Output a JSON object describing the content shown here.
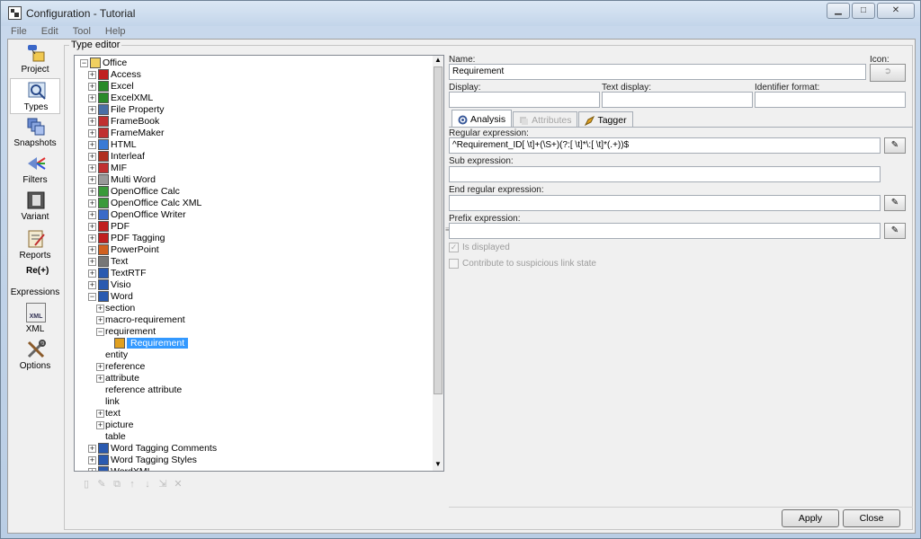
{
  "window": {
    "title": "Configuration - Tutorial"
  },
  "menu": [
    "File",
    "Edit",
    "Tool",
    "Help"
  ],
  "sidebar": [
    {
      "label": "Project",
      "icon": "project-icon"
    },
    {
      "label": "Types",
      "icon": "types-icon",
      "active": true
    },
    {
      "label": "Snapshots",
      "icon": "snapshots-icon"
    },
    {
      "label": "Filters",
      "icon": "filters-icon"
    },
    {
      "label": "Variant",
      "icon": "variant-icon"
    },
    {
      "label": "Reports",
      "icon": "reports-icon"
    },
    {
      "label": "Expressions",
      "icon": "expressions-icon",
      "icon_text": "Re(+)"
    },
    {
      "label": "XML",
      "icon": "xml-icon",
      "icon_text": "XML"
    },
    {
      "label": "Options",
      "icon": "options-icon"
    }
  ],
  "type_editor": {
    "group_title": "Type editor"
  },
  "tree": [
    {
      "label": "Office",
      "depth": 0,
      "exp": "−",
      "icon": "folder-icon",
      "color": "#f0d060"
    },
    {
      "label": "Access",
      "depth": 1,
      "exp": "+",
      "icon": "access-icon",
      "color": "#c02020"
    },
    {
      "label": "Excel",
      "depth": 1,
      "exp": "+",
      "icon": "excel-icon",
      "color": "#2a8a2a"
    },
    {
      "label": "ExcelXML",
      "depth": 1,
      "exp": "+",
      "icon": "excel-xml-icon",
      "color": "#2a8a2a"
    },
    {
      "label": "File Property",
      "depth": 1,
      "exp": "+",
      "icon": "file-property-icon",
      "color": "#4a6fa5"
    },
    {
      "label": "FrameBook",
      "depth": 1,
      "exp": "+",
      "icon": "framebook-icon",
      "color": "#c03030"
    },
    {
      "label": "FrameMaker",
      "depth": 1,
      "exp": "+",
      "icon": "framemaker-icon",
      "color": "#c03030"
    },
    {
      "label": "HTML",
      "depth": 1,
      "exp": "+",
      "icon": "html-icon",
      "color": "#3a7ad5"
    },
    {
      "label": "Interleaf",
      "depth": 1,
      "exp": "+",
      "icon": "interleaf-icon",
      "color": "#b03020"
    },
    {
      "label": "MIF",
      "depth": 1,
      "exp": "+",
      "icon": "mif-icon",
      "color": "#c03030"
    },
    {
      "label": "Multi Word",
      "depth": 1,
      "exp": "+",
      "icon": "multi-word-icon",
      "color": "#999999"
    },
    {
      "label": "OpenOffice Calc",
      "depth": 1,
      "exp": "+",
      "icon": "oo-calc-icon",
      "color": "#3a9a3a"
    },
    {
      "label": "OpenOffice Calc XML",
      "depth": 1,
      "exp": "+",
      "icon": "oo-calc-xml-icon",
      "color": "#3a9a3a"
    },
    {
      "label": "OpenOffice Writer",
      "depth": 1,
      "exp": "+",
      "icon": "oo-writer-icon",
      "color": "#3a6ac8"
    },
    {
      "label": "PDF",
      "depth": 1,
      "exp": "+",
      "icon": "pdf-icon",
      "color": "#c02020"
    },
    {
      "label": "PDF Tagging",
      "depth": 1,
      "exp": "+",
      "icon": "pdf-tagging-icon",
      "color": "#c02020"
    },
    {
      "label": "PowerPoint",
      "depth": 1,
      "exp": "+",
      "icon": "powerpoint-icon",
      "color": "#d06020"
    },
    {
      "label": "Text",
      "depth": 1,
      "exp": "+",
      "icon": "text-icon",
      "color": "#777777"
    },
    {
      "label": "TextRTF",
      "depth": 1,
      "exp": "+",
      "icon": "text-rtf-icon",
      "color": "#2a5ab0"
    },
    {
      "label": "Visio",
      "depth": 1,
      "exp": "+",
      "icon": "visio-icon",
      "color": "#2a5ab0"
    },
    {
      "label": "Word",
      "depth": 1,
      "exp": "−",
      "icon": "word-icon",
      "color": "#2a5ab0"
    },
    {
      "label": "section",
      "depth": 2,
      "exp": "+",
      "icon": "",
      "color": ""
    },
    {
      "label": "macro-requirement",
      "depth": 2,
      "exp": "+",
      "icon": "",
      "color": ""
    },
    {
      "label": "requirement",
      "depth": 2,
      "exp": "−",
      "icon": "",
      "color": ""
    },
    {
      "label": "Requirement",
      "depth": 3,
      "exp": "",
      "icon": "requirement-icon",
      "color": "#e0a020",
      "selected": true
    },
    {
      "label": "entity",
      "depth": 2,
      "exp": "",
      "icon": "",
      "color": ""
    },
    {
      "label": "reference",
      "depth": 2,
      "exp": "+",
      "icon": "",
      "color": ""
    },
    {
      "label": "attribute",
      "depth": 2,
      "exp": "+",
      "icon": "",
      "color": ""
    },
    {
      "label": "reference attribute",
      "depth": 2,
      "exp": "",
      "icon": "",
      "color": ""
    },
    {
      "label": "link",
      "depth": 2,
      "exp": "",
      "icon": "",
      "color": ""
    },
    {
      "label": "text",
      "depth": 2,
      "exp": "+",
      "icon": "",
      "color": ""
    },
    {
      "label": "picture",
      "depth": 2,
      "exp": "+",
      "icon": "",
      "color": ""
    },
    {
      "label": "table",
      "depth": 2,
      "exp": "",
      "icon": "",
      "color": ""
    },
    {
      "label": "Word Tagging Comments",
      "depth": 1,
      "exp": "+",
      "icon": "word-tagging-comments-icon",
      "color": "#2a5ab0"
    },
    {
      "label": "Word Tagging Styles",
      "depth": 1,
      "exp": "+",
      "icon": "word-tagging-styles-icon",
      "color": "#2a5ab0"
    },
    {
      "label": "WordXML",
      "depth": 1,
      "exp": "+",
      "icon": "word-xml-icon",
      "color": "#2a5ab0"
    }
  ],
  "tree_tools": [
    "new-icon",
    "edit-icon",
    "copy-icon",
    "move-up-icon",
    "move-down-icon",
    "import-icon",
    "delete-icon"
  ],
  "form": {
    "name_label": "Name:",
    "name_value": "Requirement",
    "icon_label": "Icon:",
    "display_label": "Display:",
    "text_display_label": "Text display:",
    "identifier_format_label": "Identifier format:",
    "tabs": [
      {
        "label": "Analysis",
        "icon": "analysis-icon",
        "active": true,
        "disabled": false
      },
      {
        "label": "Attributes",
        "icon": "attributes-icon",
        "active": false,
        "disabled": true
      },
      {
        "label": "Tagger",
        "icon": "tagger-icon",
        "active": false,
        "disabled": false
      }
    ],
    "regex_label": "Regular expression:",
    "regex_value": "^Requirement_ID[ \\t]+(\\S+)(?:[ \\t]*\\:[ \\t]*(.+))$",
    "sub_label": "Sub expression:",
    "end_label": "End regular expression:",
    "prefix_label": "Prefix expression:",
    "is_displayed_label": "Is displayed",
    "is_displayed_checked": true,
    "suspicious_label": "Contribute to suspicious link state",
    "suspicious_checked": false
  },
  "buttons": {
    "apply": "Apply",
    "close": "Close"
  }
}
